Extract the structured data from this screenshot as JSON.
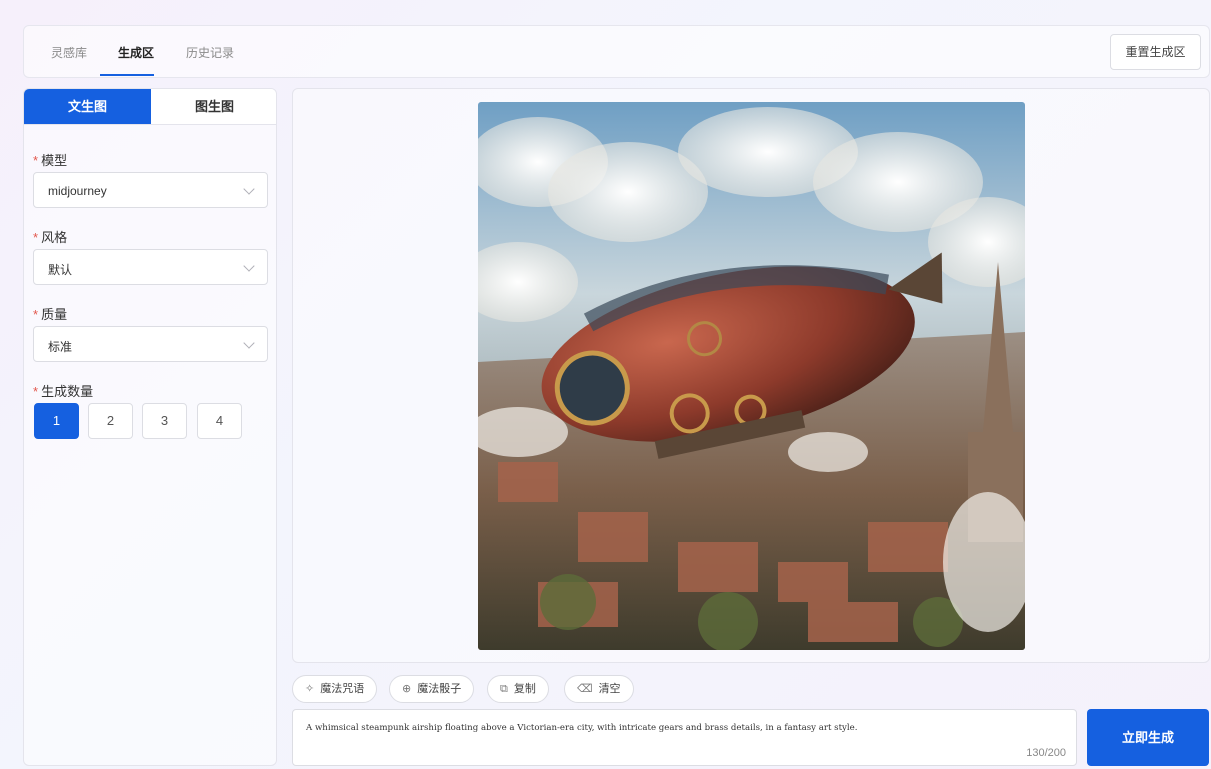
{
  "header": {
    "tabs": [
      {
        "label": "灵感库"
      },
      {
        "label": "生成区"
      },
      {
        "label": "历史记录"
      }
    ],
    "active_tab": "生成区",
    "reset_label": "重置生成区"
  },
  "left": {
    "mode_tabs": [
      {
        "label": "文生图"
      },
      {
        "label": "图生图"
      }
    ],
    "active_mode": "文生图",
    "required_mark": "*",
    "model": {
      "label": "模型",
      "value": "midjourney"
    },
    "style": {
      "label": "风格",
      "value": "默认"
    },
    "quality": {
      "label": "质量",
      "value": "标准"
    },
    "count": {
      "label": "生成数量",
      "options": [
        "1",
        "2",
        "3",
        "4"
      ],
      "selected": "1"
    }
  },
  "toolbar": {
    "magic_prompt_label": "魔法咒语",
    "magic_dice_label": "魔法骰子",
    "copy_label": "复制",
    "clear_label": "清空"
  },
  "prompt": {
    "text": "A whimsical steampunk airship floating above a Victorian-era city, with intricate gears and brass details, in a fantasy art style.",
    "counter": "130/200"
  },
  "generate_label": "立即生成",
  "colors": {
    "accent": "#1560e0",
    "required": "#e2574c"
  },
  "icons": {
    "magic_prompt": "sparkle-icon",
    "magic_dice": "dice-icon",
    "copy": "copy-icon",
    "clear": "trash-icon"
  }
}
